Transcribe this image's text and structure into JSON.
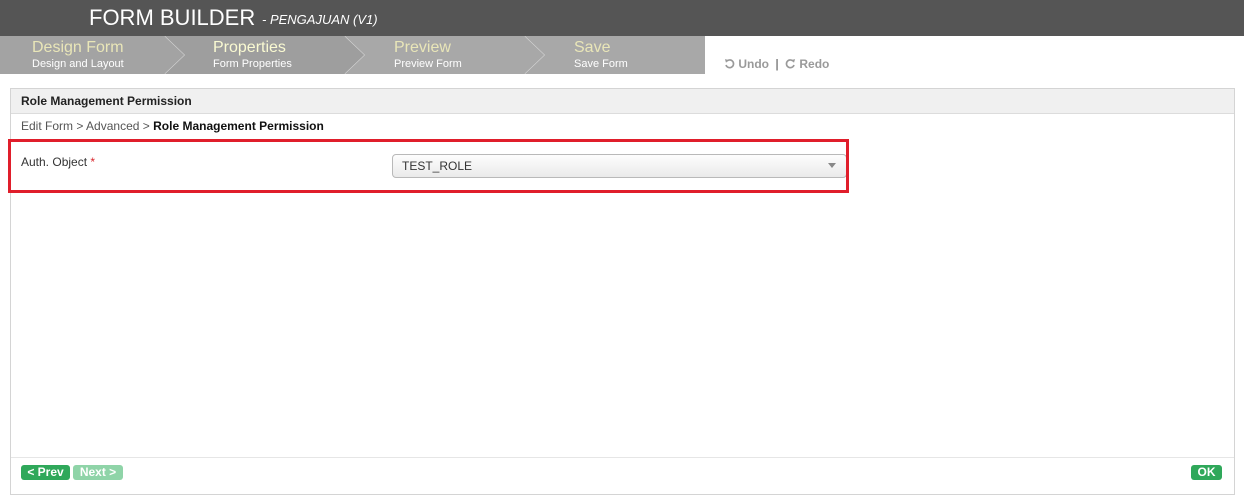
{
  "header": {
    "title": "FORM BUILDER",
    "subtitle": "- PENGAJUAN (V1)"
  },
  "wizard": {
    "steps": [
      {
        "label": "Design Form",
        "sub": "Design and Layout"
      },
      {
        "label": "Properties",
        "sub": "Form Properties"
      },
      {
        "label": "Preview",
        "sub": "Preview Form"
      },
      {
        "label": "Save",
        "sub": "Save Form"
      }
    ],
    "undo_label": "Undo",
    "redo_label": "Redo",
    "separator": "|"
  },
  "panel": {
    "title": "Role Management Permission",
    "breadcrumb": {
      "items": [
        "Edit Form",
        "Advanced",
        "Role Management Permission"
      ],
      "separator": ">"
    },
    "field": {
      "label": "Auth. Object",
      "required_mark": "*",
      "value": "TEST_ROLE"
    }
  },
  "footer": {
    "prev_label": "< Prev",
    "next_label": "Next >",
    "ok_label": "OK"
  },
  "colors": {
    "header_bg": "#555555",
    "step_bg": "#a8a8a8",
    "step_label": "#e9e6b8",
    "highlight": "#e01e2b",
    "button_green": "#2fa85a",
    "button_disabled": "#8fd4a8"
  }
}
